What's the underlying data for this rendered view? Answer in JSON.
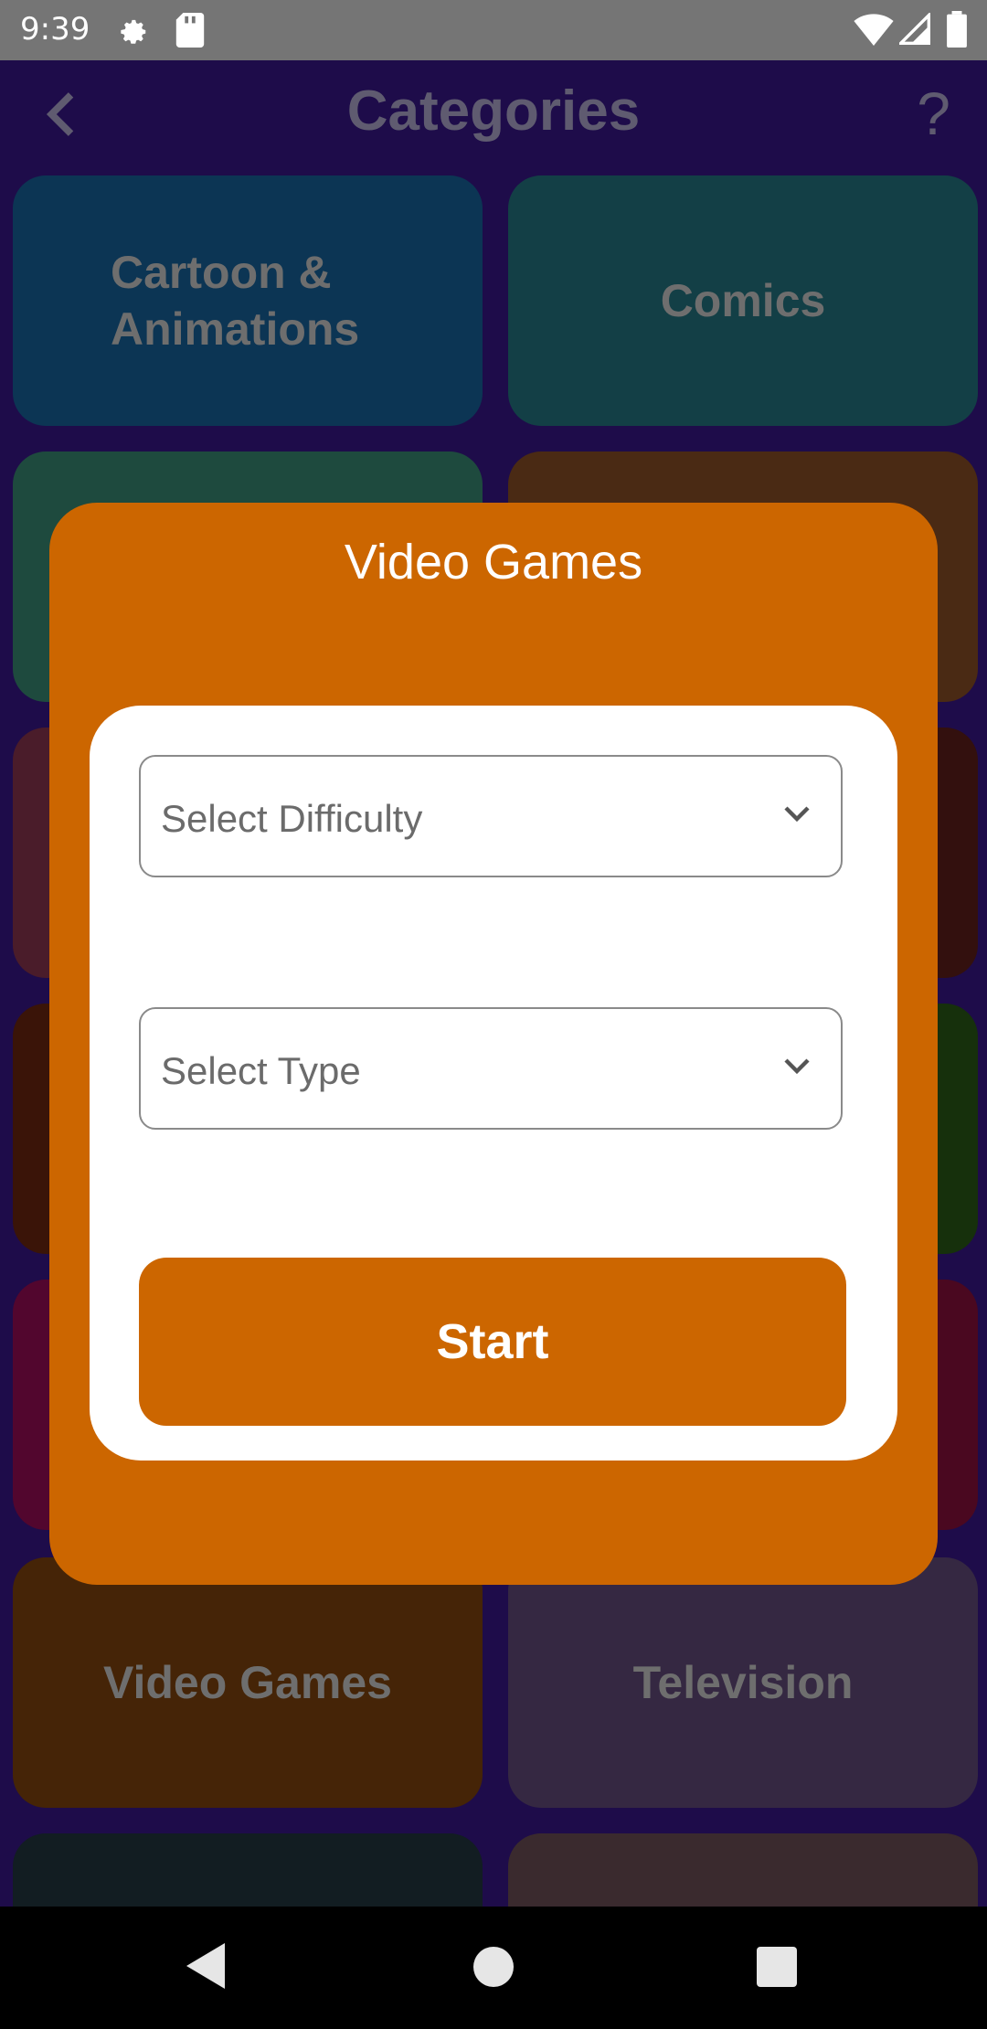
{
  "status_bar": {
    "time": "9:39"
  },
  "app_bar": {
    "title": "Categories",
    "help_label": "?"
  },
  "categories": [
    {
      "label": "Cartoon & Animations",
      "color": "#0c3554"
    },
    {
      "label": "Comics",
      "color": "#133f46"
    },
    {
      "label": "Video Games",
      "color": "#452407"
    },
    {
      "label": "Television",
      "color": "#352842"
    }
  ],
  "dialog": {
    "title": "Video Games",
    "difficulty_placeholder": "Select Difficulty",
    "type_placeholder": "Select Type",
    "start_label": "Start",
    "accent_color": "#cc6600"
  }
}
